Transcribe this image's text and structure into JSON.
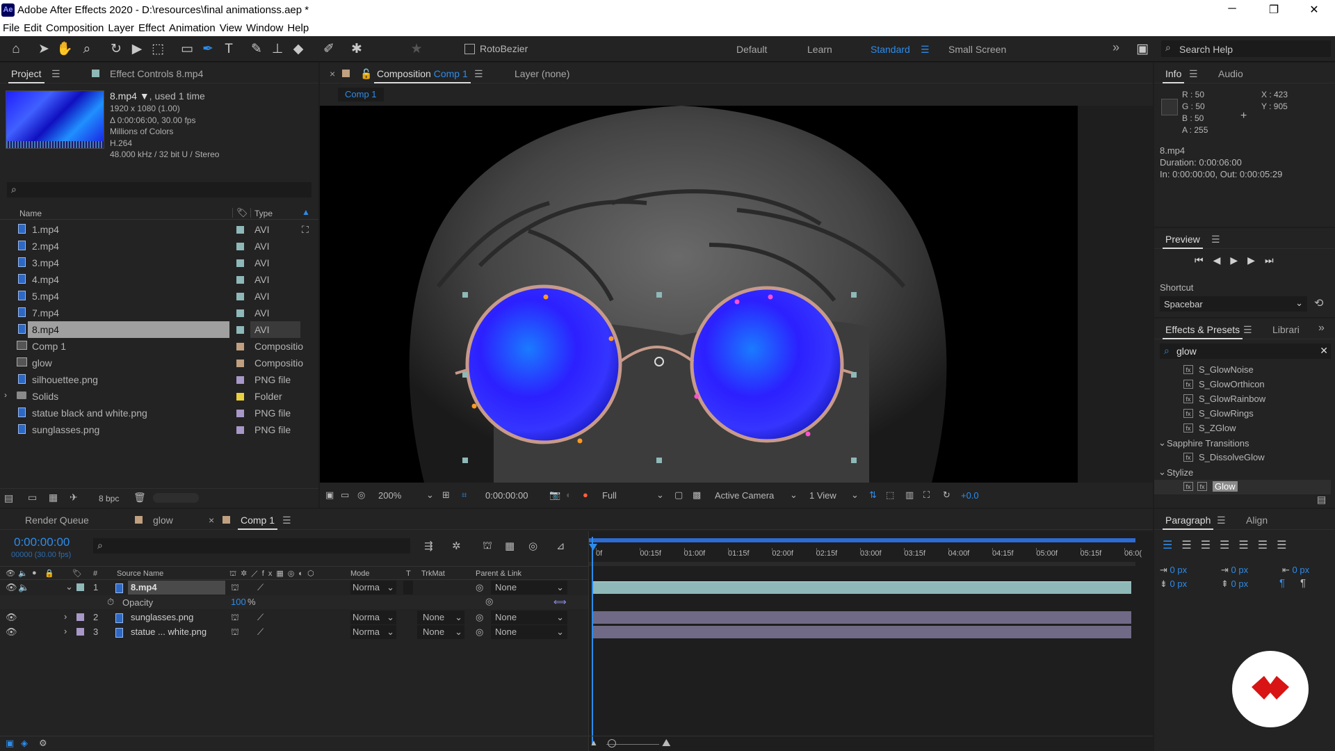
{
  "app": {
    "logo": "Ae",
    "title": "Adobe After Effects 2020 - D:\\resources\\final animationss.aep *",
    "win_minimize": "─",
    "win_restore": "❐",
    "win_close": "✕"
  },
  "menu": [
    "File",
    "Edit",
    "Composition",
    "Layer",
    "Effect",
    "Animation",
    "View",
    "Window",
    "Help"
  ],
  "toolbar": {
    "rotobezier": "RotoBezier",
    "workspaces": [
      "Default",
      "Learn",
      "Standard",
      "Small Screen"
    ],
    "active_workspace": "Standard",
    "search_help": "Search Help",
    "more": "»"
  },
  "project": {
    "tab": "Project",
    "effect_controls_tab": "Effect Controls 8.mp4",
    "selected_name": "8.mp4",
    "used": ", used 1 time",
    "info_lines": [
      "1920 x 1080 (1.00)",
      "Δ 0:00:06:00, 30.00 fps",
      "Millions of Colors",
      "H.264",
      "48.000 kHz / 32 bit U / Stereo"
    ],
    "search_placeholder": "",
    "col_name": "Name",
    "col_type": "Type",
    "bpc": "8 bpc",
    "items": [
      {
        "name": "1.mp4",
        "type": "AVI",
        "icon": "file-icon",
        "color": "#8fb8b8"
      },
      {
        "name": "2.mp4",
        "type": "AVI",
        "icon": "file-icon",
        "color": "#8fb8b8"
      },
      {
        "name": "3.mp4",
        "type": "AVI",
        "icon": "file-icon",
        "color": "#8fb8b8"
      },
      {
        "name": "4.mp4",
        "type": "AVI",
        "icon": "file-icon",
        "color": "#8fb8b8"
      },
      {
        "name": "5.mp4",
        "type": "AVI",
        "icon": "file-icon",
        "color": "#8fb8b8"
      },
      {
        "name": "7.mp4",
        "type": "AVI",
        "icon": "file-icon",
        "color": "#8fb8b8"
      },
      {
        "name": "8.mp4",
        "type": "AVI",
        "icon": "file-icon",
        "color": "#8fb8b8",
        "selected": true
      },
      {
        "name": "Comp 1",
        "type": "Compositio",
        "icon": "composition-icon",
        "color": "#c0a080"
      },
      {
        "name": "glow",
        "type": "Compositio",
        "icon": "composition-icon",
        "color": "#c0a080"
      },
      {
        "name": "silhouettee.png",
        "type": "PNG file",
        "icon": "file-icon",
        "color": "#a898c8"
      },
      {
        "name": "Solids",
        "type": "Folder",
        "icon": "folder-icon",
        "color": "#e8d040"
      },
      {
        "name": "statue black and white.png",
        "type": "PNG file",
        "icon": "file-icon",
        "color": "#a898c8"
      },
      {
        "name": "sunglasses.png",
        "type": "PNG file",
        "icon": "file-icon",
        "color": "#a898c8"
      }
    ]
  },
  "composition": {
    "close": "×",
    "tab_prefix": "Composition",
    "tab_name": "Comp 1",
    "layer_tab": "Layer  (none)",
    "breadcrumb": "Comp 1",
    "zoom": "200%",
    "timecode": "0:00:00:00",
    "resolution": "Full",
    "camera": "Active Camera",
    "views": "1 View",
    "exposure": "+0.0"
  },
  "info": {
    "tab": "Info",
    "audio_tab": "Audio",
    "r": "R : 50",
    "g": "G : 50",
    "b": "B : 50",
    "a": "A :  255",
    "x": "X : 423",
    "y": "Y : 905",
    "file": "8.mp4",
    "duration": "Duration: 0:00:06:00",
    "inout": "In: 0:00:00:00, Out: 0:00:05:29"
  },
  "preview": {
    "tab": "Preview",
    "shortcut_label": "Shortcut",
    "shortcut_value": "Spacebar"
  },
  "effects": {
    "tab": "Effects & Presets",
    "libraries_tab": "Librari",
    "search_value": "glow",
    "items": [
      {
        "label": "S_GlowNoise",
        "kind": "effect"
      },
      {
        "label": "S_GlowOrthicon",
        "kind": "effect"
      },
      {
        "label": "S_GlowRainbow",
        "kind": "effect"
      },
      {
        "label": "S_GlowRings",
        "kind": "effect"
      },
      {
        "label": "S_ZGlow",
        "kind": "effect"
      },
      {
        "label": "Sapphire Transitions",
        "kind": "category"
      },
      {
        "label": "S_DissolveGlow",
        "kind": "effect"
      },
      {
        "label": "Stylize",
        "kind": "category"
      },
      {
        "label": "Glow",
        "kind": "effect",
        "highlight": true
      }
    ]
  },
  "timeline": {
    "render_queue_tab": "Render Queue",
    "glow_tab": "glow",
    "comp_tab": "Comp 1",
    "close": "×",
    "timecode": "0:00:00:00",
    "frames": "00000 (30.00 fps)",
    "col_hash": "#",
    "col_source": "Source Name",
    "col_mode": "Mode",
    "col_t": "T",
    "col_trkmat": "TrkMat",
    "col_parent": "Parent & Link",
    "ruler": [
      "0f",
      "00:15f",
      "01:00f",
      "01:15f",
      "02:00f",
      "02:15f",
      "03:00f",
      "03:15f",
      "04:00f",
      "04:15f",
      "05:00f",
      "05:15f",
      "06:0("
    ],
    "layers": [
      {
        "num": "1",
        "name": "8.mp4",
        "mode": "Norma",
        "trkmat": "",
        "parent": "None",
        "color": "#8fb8b8",
        "expanded": true
      },
      {
        "num": "2",
        "name": "sunglasses.png",
        "mode": "Norma",
        "trkmat": "None",
        "parent": "None",
        "color": "#a898c8"
      },
      {
        "num": "3",
        "name": "statue ... white.png",
        "mode": "Norma",
        "trkmat": "None",
        "parent": "None",
        "color": "#a898c8"
      }
    ],
    "opacity_label": "Opacity",
    "opacity_value": "100",
    "opacity_unit": "%"
  },
  "paragraph": {
    "tab": "Paragraph",
    "align_tab": "Align",
    "indent_values": [
      "0 px",
      "0 px",
      "0 px",
      "0 px",
      "0 px"
    ]
  },
  "colors": {
    "accent": "#2d8ceb",
    "panel": "#232323",
    "bg": "#1d1d1d",
    "comp_bg": "#000000",
    "lens": "#2b22ff",
    "track1": "#8fb8b8",
    "track2": "#7c7c90"
  }
}
